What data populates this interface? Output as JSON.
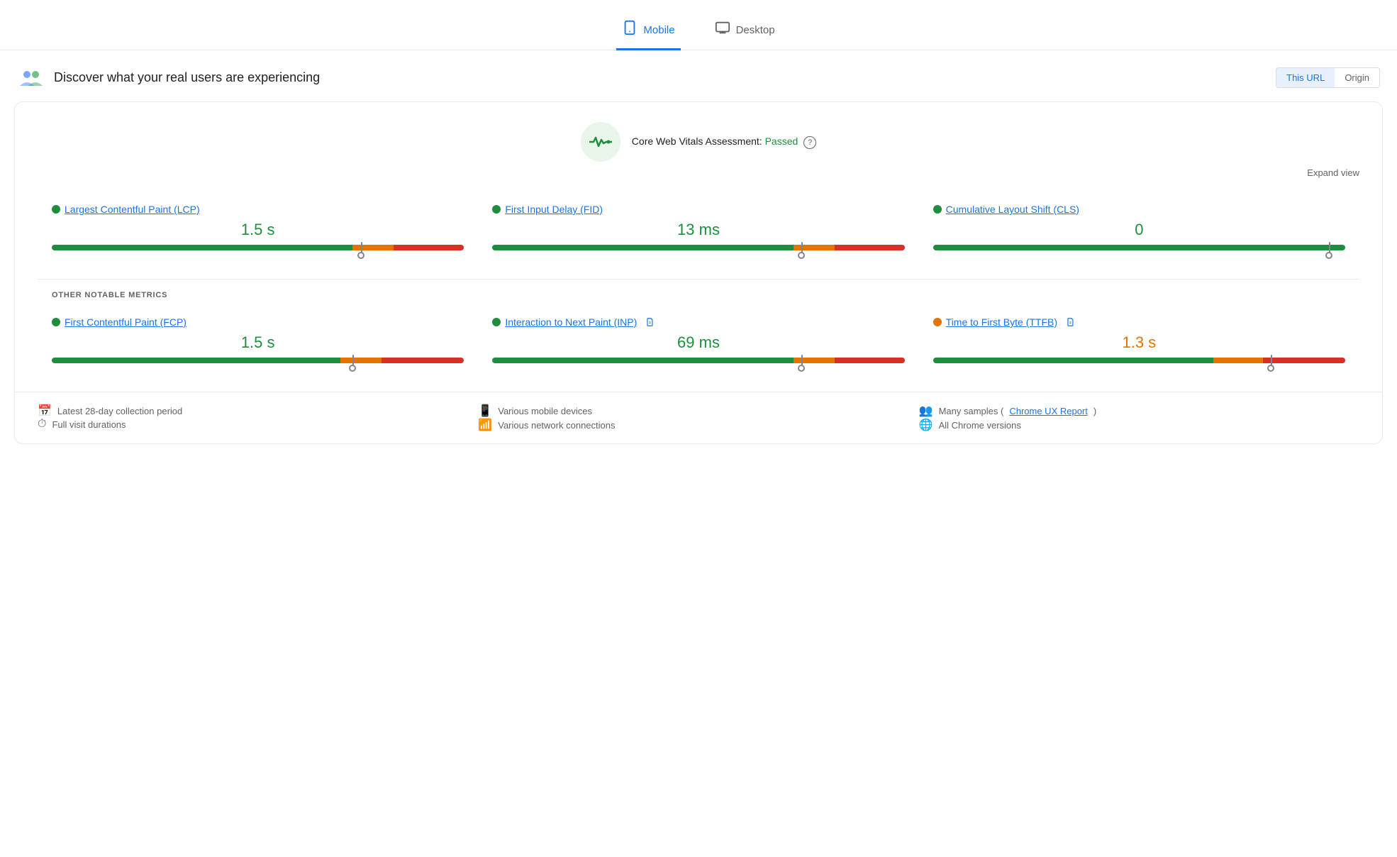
{
  "tabs": {
    "mobile": {
      "label": "Mobile",
      "active": true
    },
    "desktop": {
      "label": "Desktop",
      "active": false
    }
  },
  "header": {
    "title": "Discover what your real users are experiencing",
    "url_button": "This URL",
    "origin_button": "Origin"
  },
  "assessment": {
    "title": "Core Web Vitals Assessment:",
    "status": "Passed",
    "expand_label": "Expand view",
    "help": "?"
  },
  "core_metrics": [
    {
      "id": "lcp",
      "name": "Largest Contentful Paint (LCP)",
      "value": "1.5 s",
      "value_color": "green",
      "dot_color": "green",
      "bar": {
        "green": 73,
        "orange": 10,
        "red": 17,
        "marker_pct": 75
      }
    },
    {
      "id": "fid",
      "name": "First Input Delay (FID)",
      "value": "13 ms",
      "value_color": "green",
      "dot_color": "green",
      "bar": {
        "green": 73,
        "orange": 10,
        "red": 17,
        "marker_pct": 75
      }
    },
    {
      "id": "cls",
      "name": "Cumulative Layout Shift (CLS)",
      "value": "0",
      "value_color": "green",
      "dot_color": "green",
      "bar": {
        "green": 100,
        "orange": 0,
        "red": 0,
        "marker_pct": 96
      }
    }
  ],
  "other_metrics_label": "OTHER NOTABLE METRICS",
  "other_metrics": [
    {
      "id": "fcp",
      "name": "First Contentful Paint (FCP)",
      "value": "1.5 s",
      "value_color": "green",
      "dot_color": "green",
      "has_beta": false,
      "bar": {
        "green": 70,
        "orange": 10,
        "red": 20,
        "marker_pct": 73
      }
    },
    {
      "id": "inp",
      "name": "Interaction to Next Paint (INP)",
      "value": "69 ms",
      "value_color": "green",
      "dot_color": "green",
      "has_beta": true,
      "bar": {
        "green": 73,
        "orange": 10,
        "red": 17,
        "marker_pct": 75
      }
    },
    {
      "id": "ttfb",
      "name": "Time to First Byte (TTFB)",
      "value": "1.3 s",
      "value_color": "orange",
      "dot_color": "orange",
      "has_beta": true,
      "bar": {
        "green": 68,
        "orange": 12,
        "red": 20,
        "marker_pct": 82
      }
    }
  ],
  "footer": {
    "col1": [
      {
        "icon": "📅",
        "text": "Latest 28-day collection period"
      },
      {
        "icon": "⏱",
        "text": "Full visit durations"
      }
    ],
    "col2": [
      {
        "icon": "📱",
        "text": "Various mobile devices"
      },
      {
        "icon": "📶",
        "text": "Various network connections"
      }
    ],
    "col3": [
      {
        "icon": "👥",
        "text": "Many samples (",
        "link": "Chrome UX Report",
        "text_after": ")"
      },
      {
        "icon": "🌐",
        "text": "All Chrome versions"
      }
    ]
  }
}
